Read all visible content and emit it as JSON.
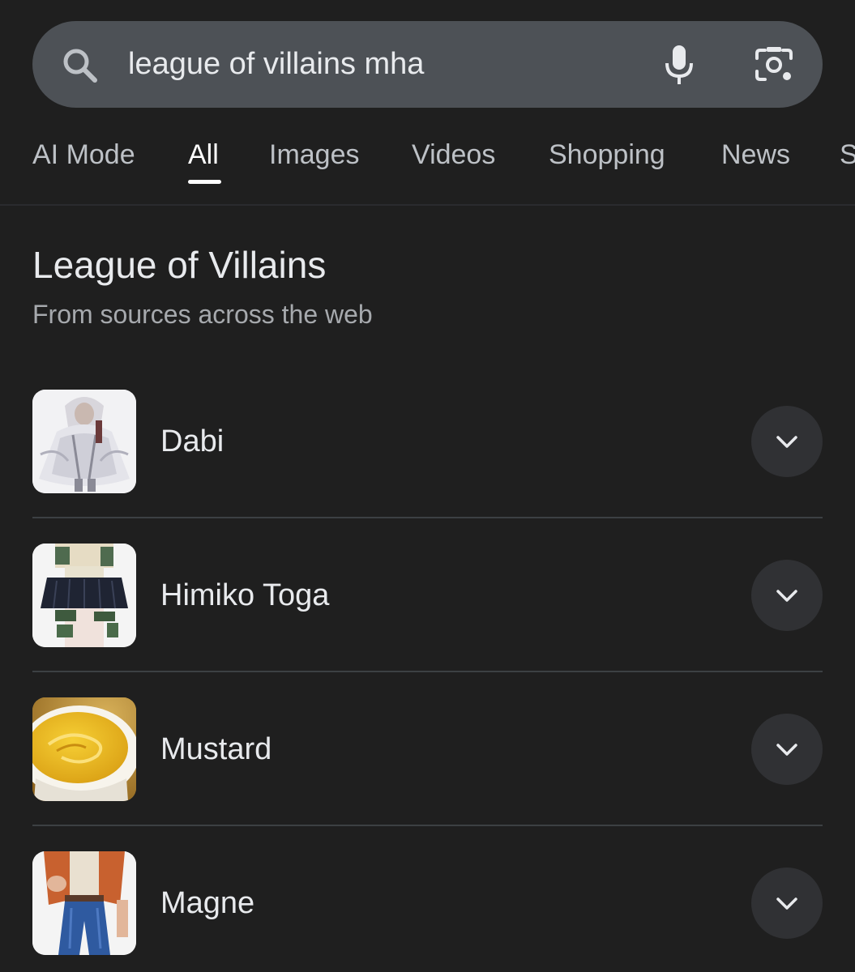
{
  "search": {
    "query": "league of villains mha",
    "icons": [
      "search-icon",
      "mic-icon",
      "lens-icon"
    ]
  },
  "tabs": [
    {
      "label": "AI Mode",
      "active": false
    },
    {
      "label": "All",
      "active": true
    },
    {
      "label": "Images",
      "active": false
    },
    {
      "label": "Videos",
      "active": false
    },
    {
      "label": "Shopping",
      "active": false
    },
    {
      "label": "News",
      "active": false
    },
    {
      "label": "S",
      "active": false
    }
  ],
  "section": {
    "title": "League of Villains",
    "subtitle": "From sources across the web"
  },
  "entities": [
    {
      "name": "Dabi",
      "icon": "chevron-down-icon"
    },
    {
      "name": "Himiko Toga",
      "icon": "chevron-down-icon"
    },
    {
      "name": "Mustard",
      "icon": "chevron-down-icon"
    },
    {
      "name": "Magne",
      "icon": "chevron-down-icon"
    }
  ],
  "colors": {
    "background": "#1f1f1f",
    "search_bar": "#4d5156",
    "text_primary": "#e8eaed",
    "text_secondary": "#a6a9ad",
    "expand_button": "#303134"
  }
}
